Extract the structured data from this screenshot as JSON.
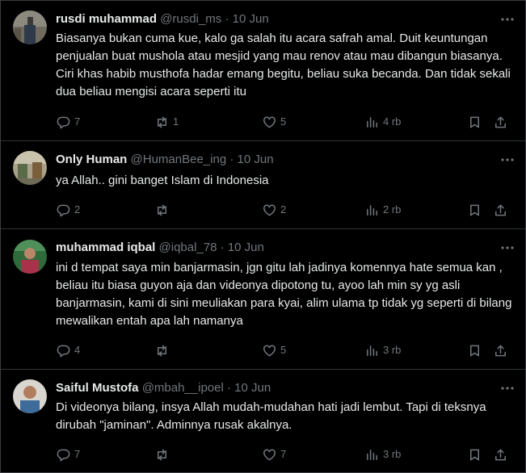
{
  "tweets": [
    {
      "name": "rusdi muhammad",
      "handle": "@rusdi_ms",
      "separator": "·",
      "date": "10 Jun",
      "text": "Biasanya bukan cuma kue, kalo ga salah itu acara safrah amal. Duit keuntungan penjualan buat mushola atau mesjid yang mau renov atau mau dibangun biasanya. Ciri khas habib musthofa hadar emang begitu, beliau suka becanda. Dan tidak sekali dua beliau mengisi acara seperti itu",
      "replies": "7",
      "reposts": "1",
      "likes": "5",
      "views": "4 rb"
    },
    {
      "name": "Only Human",
      "handle": "@HumanBee_ing",
      "separator": "·",
      "date": "10 Jun",
      "text": "ya Allah.. gini banget Islam di Indonesia",
      "replies": "2",
      "reposts": "",
      "likes": "2",
      "views": "2 rb"
    },
    {
      "name": "muhammad iqbal",
      "handle": "@iqbal_78",
      "separator": "·",
      "date": "10 Jun",
      "text": "ini d tempat saya min banjarmasin, jgn gitu lah jadinya komennya hate semua kan , beliau itu biasa guyon aja dan videonya dipotong tu, ayoo lah min sy yg asli banjarmasin, kami di sini meuliakan para kyai, alim ulama tp tidak yg seperti di bilang mewalikan entah apa lah namanya",
      "replies": "4",
      "reposts": "",
      "likes": "5",
      "views": "3 rb"
    },
    {
      "name": "Saiful Mustofa",
      "handle": "@mbah__ipoel",
      "separator": "·",
      "date": "10 Jun",
      "text": "Di videonya bilang, insya Allah mudah-mudahan hati jadi lembut. Tapi di teksnya dirubah \"jaminan\". Adminnya rusak akalnya.",
      "replies": "7",
      "reposts": "",
      "likes": "7",
      "views": "3 rb"
    }
  ],
  "icons": {
    "reply": "reply-icon",
    "repost": "repost-icon",
    "like": "like-icon",
    "views": "views-icon",
    "bookmark": "bookmark-icon",
    "share": "share-icon",
    "more": "more-icon"
  },
  "colors": {
    "background": "#000000",
    "text": "#e7e9ea",
    "muted": "#71767b",
    "divider": "#2f3336"
  }
}
